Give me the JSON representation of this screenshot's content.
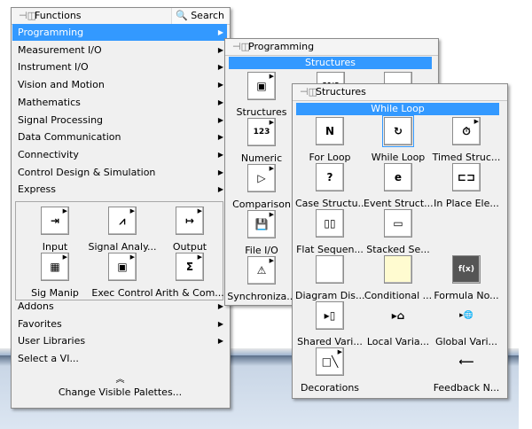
{
  "colors": {
    "highlight": "#3399ff"
  },
  "functions": {
    "title": "Functions",
    "search_label": "Search",
    "items_top": [
      "Programming",
      "Measurement I/O",
      "Instrument I/O",
      "Vision and Motion",
      "Mathematics",
      "Signal Processing",
      "Data Communication",
      "Connectivity",
      "Control Design & Simulation",
      "Express"
    ],
    "express_tiles": [
      {
        "label": "Input",
        "icon": "input-icon",
        "glyph": "⇥"
      },
      {
        "label": "Signal Analy...",
        "icon": "signal-analysis-icon",
        "glyph": "⩘"
      },
      {
        "label": "Output",
        "icon": "output-icon",
        "glyph": "↦"
      },
      {
        "label": "Sig Manip",
        "icon": "signal-manipulation-icon",
        "glyph": "▦"
      },
      {
        "label": "Exec Control",
        "icon": "exec-control-icon",
        "glyph": "▣"
      },
      {
        "label": "Arith & Com...",
        "icon": "arithmetic-icon",
        "glyph": "Σ"
      }
    ],
    "items_bottom": [
      "Addons",
      "Favorites",
      "User Libraries",
      "Select a VI..."
    ],
    "expand_icon": "double-chevron-up-icon",
    "change_palettes": "Change Visible Palettes..."
  },
  "programming": {
    "title": "Programming",
    "hover_label": "Structures",
    "tiles": [
      {
        "label": "Structures",
        "icon": "structures-icon",
        "glyph": "▣"
      },
      {
        "label": "Numeric",
        "icon": "numeric-icon",
        "glyph": "123"
      },
      {
        "label": "Comparison",
        "icon": "comparison-icon",
        "glyph": "▷"
      },
      {
        "label": "File I/O",
        "icon": "file-io-icon",
        "glyph": "💾"
      },
      {
        "label": "Synchroniza...",
        "icon": "synchronization-icon",
        "glyph": "⚠"
      }
    ]
  },
  "structures": {
    "title": "Structures",
    "hover_label": "While Loop",
    "tiles": [
      {
        "label": "For Loop",
        "icon": "for-loop-icon",
        "glyph": "N"
      },
      {
        "label": "While Loop",
        "icon": "while-loop-icon",
        "glyph": "↻",
        "selected": true
      },
      {
        "label": "Timed Struc...",
        "icon": "timed-structure-icon",
        "glyph": "⏱"
      },
      {
        "label": "Case Structu...",
        "icon": "case-structure-icon",
        "glyph": "?"
      },
      {
        "label": "Event Struct...",
        "icon": "event-structure-icon",
        "glyph": "e"
      },
      {
        "label": "In Place Ele...",
        "icon": "in-place-element-icon",
        "glyph": "⊏⊐"
      },
      {
        "label": "Flat Sequen...",
        "icon": "flat-sequence-icon",
        "glyph": "▯▯"
      },
      {
        "label": "Stacked Se...",
        "icon": "stacked-sequence-icon",
        "glyph": "▭"
      },
      null,
      {
        "label": "Diagram Dis...",
        "icon": "diagram-disable-icon",
        "glyph": ""
      },
      {
        "label": "Conditional ...",
        "icon": "conditional-disable-icon",
        "glyph": ""
      },
      {
        "label": "Formula No...",
        "icon": "formula-node-icon",
        "glyph": "f(x)"
      },
      {
        "label": "Shared Vari...",
        "icon": "shared-variable-icon",
        "glyph": "▸▯"
      },
      {
        "label": "Local Varia...",
        "icon": "local-variable-icon",
        "glyph": "▸⌂",
        "plain": true
      },
      {
        "label": "Global Vari...",
        "icon": "global-variable-icon",
        "glyph": "▸🌐",
        "plain": true
      },
      {
        "label": "Decorations",
        "icon": "decorations-icon",
        "glyph": "□╲"
      },
      null,
      {
        "label": "Feedback N...",
        "icon": "feedback-node-icon",
        "glyph": "⟵",
        "plain": true
      }
    ]
  }
}
